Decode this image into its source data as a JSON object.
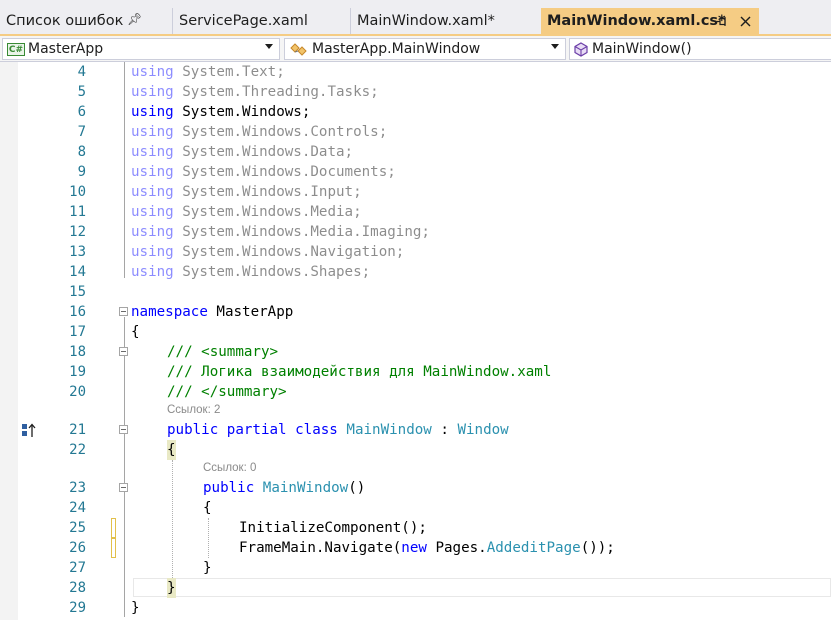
{
  "tabs": [
    {
      "label": "Список ошибок",
      "pinned": true,
      "active": false
    },
    {
      "label": "ServicePage.xaml",
      "active": false
    },
    {
      "label": "MainWindow.xaml*",
      "active": false
    },
    {
      "label": "MainWindow.xaml.cs*",
      "active": true
    }
  ],
  "tab_icons": {
    "pin": "⊹",
    "close": "✕"
  },
  "navbar": {
    "project": "MasterApp",
    "class": "MasterApp.MainWindow",
    "member": "MainWindow()",
    "project_icon": "C#"
  },
  "lines": [
    {
      "num": "4",
      "text": "System.Text;"
    },
    {
      "num": "5",
      "text": "System.Threading.Tasks;"
    },
    {
      "num": "6",
      "text": "System.Windows;"
    },
    {
      "num": "7",
      "text": "System.Windows.Controls;"
    },
    {
      "num": "8",
      "text": "System.Windows.Data;"
    },
    {
      "num": "9",
      "text": "System.Windows.Documents;"
    },
    {
      "num": "10",
      "text": "System.Windows.Input;"
    },
    {
      "num": "11",
      "text": "System.Windows.Media;"
    },
    {
      "num": "12",
      "text": "System.Windows.Media.Imaging;"
    },
    {
      "num": "13",
      "text": "System.Windows.Navigation;"
    },
    {
      "num": "14",
      "text": "System.Windows.Shapes;"
    },
    {
      "num": "15",
      "text": ""
    },
    {
      "num": "16",
      "text": "MasterApp"
    },
    {
      "num": "17",
      "text": "{"
    },
    {
      "num": "18",
      "text": "/// <summary>"
    },
    {
      "num": "19",
      "text": "/// Логика взаимодействия для MainWindow.xaml"
    },
    {
      "num": "20",
      "text": "/// </summary>"
    },
    {
      "num": "21",
      "text": ""
    },
    {
      "num": "22",
      "text": "{"
    },
    {
      "num": "23",
      "text": ""
    },
    {
      "num": "24",
      "text": "{"
    },
    {
      "num": "25",
      "text": "InitializeComponent();"
    },
    {
      "num": "26",
      "text": ""
    },
    {
      "num": "27",
      "text": "}"
    },
    {
      "num": "28",
      "text": "}"
    },
    {
      "num": "29",
      "text": "}"
    }
  ],
  "keywords": {
    "using": "using",
    "namespace": "namespace",
    "public": "public",
    "partial": "partial",
    "class": "class",
    "new": "new"
  },
  "code_parts": {
    "class_name": "MainWindow",
    "colon": " : ",
    "base_class": "Window",
    "ctor_name": "MainWindow",
    "ctor_parens": "()",
    "navigate_prefix": "FrameMain.Navigate(",
    "pages": " Pages.",
    "page_type": "AddeditPage",
    "navigate_suffix": "());"
  },
  "hints": {
    "class_refs": "Ссылок: 2",
    "ctor_refs": "Ссылок: 0"
  },
  "colors": {
    "keyword": "#0000ff",
    "type": "#2b91af",
    "comment": "#008000",
    "line_number": "#237893",
    "active_tab": "#f5cc84"
  }
}
